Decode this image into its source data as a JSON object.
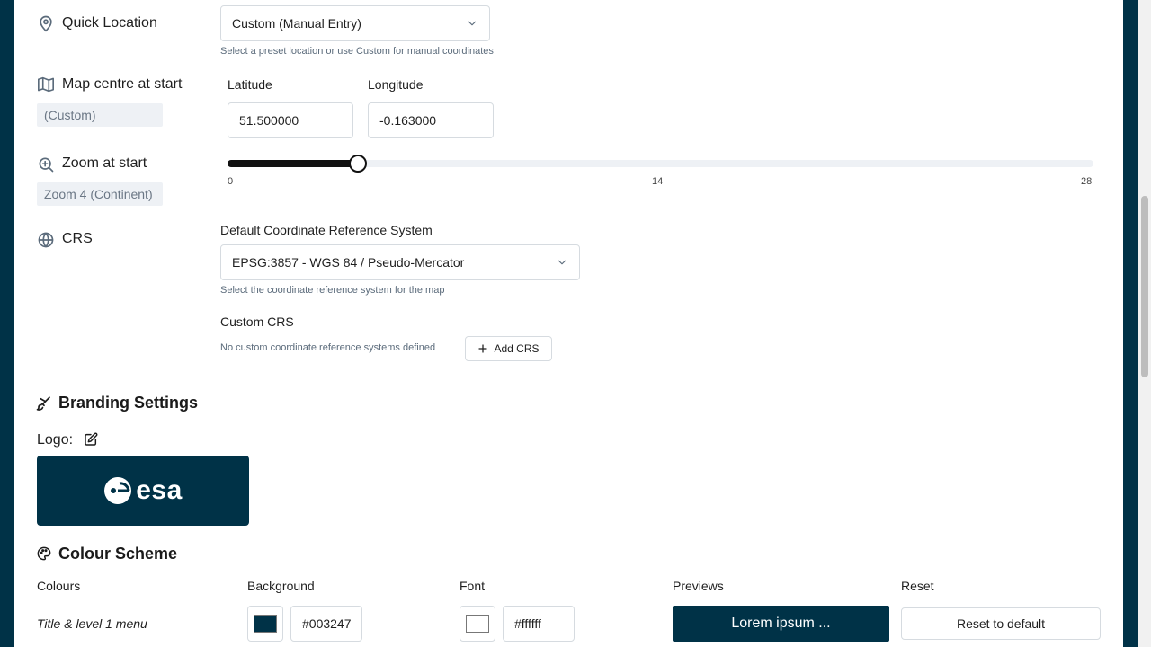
{
  "quick_location": {
    "label": "Quick Location",
    "selected": "Custom (Manual Entry)",
    "help": "Select a preset location or use Custom for manual coordinates"
  },
  "map_centre": {
    "label": "Map centre at start",
    "badge": "(Custom)",
    "latitude_label": "Latitude",
    "latitude_value": "51.500000",
    "longitude_label": "Longitude",
    "longitude_value": "-0.163000"
  },
  "zoom": {
    "label": "Zoom at start",
    "badge": "Zoom 4 (Continent)",
    "value": 4,
    "min": 0,
    "max": 28,
    "ticks": [
      "0",
      "14",
      "28"
    ]
  },
  "crs": {
    "label": "CRS",
    "default_label": "Default Coordinate Reference System",
    "selected": "EPSG:3857 - WGS 84 / Pseudo-Mercator",
    "help": "Select the coordinate reference system for the map",
    "custom_label": "Custom CRS",
    "custom_empty": "No custom coordinate reference systems defined",
    "add_button": "Add CRS"
  },
  "branding": {
    "title": "Branding Settings",
    "logo_label": "Logo:",
    "logo_text": "esa"
  },
  "colour_scheme": {
    "title": "Colour Scheme",
    "headers": {
      "colours": "Colours",
      "background": "Background",
      "font": "Font",
      "previews": "Previews",
      "reset": "Reset"
    },
    "rows": [
      {
        "name": "Title & level 1 menu",
        "background_hex": "#003247",
        "font_hex": "#ffffff",
        "preview_text": "Lorem ipsum ...",
        "reset_label": "Reset to default"
      }
    ]
  },
  "colors": {
    "brand": "#003247",
    "page_bg": "#003247",
    "panel_bg": "#ffffff"
  }
}
